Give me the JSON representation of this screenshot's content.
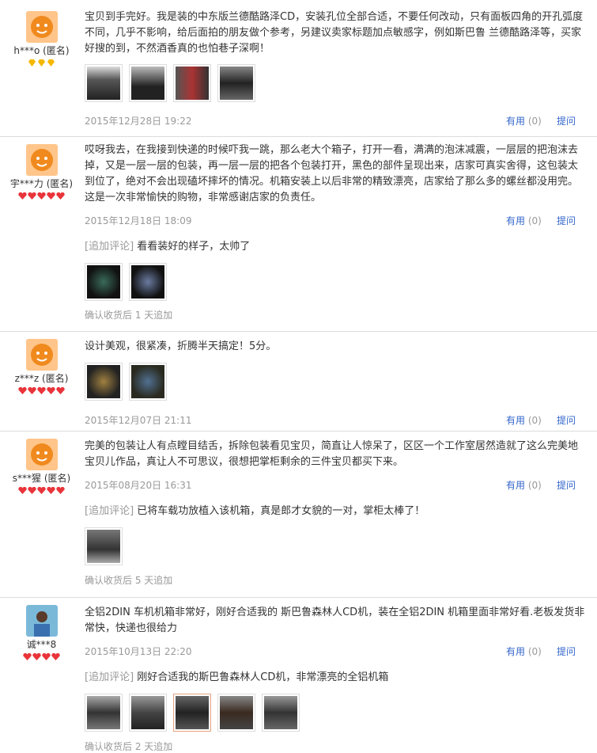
{
  "labels": {
    "useful": "有用",
    "ask": "提问",
    "append_tag": "[追加评论]"
  },
  "reviews": [
    {
      "user": "h***o (匿名)",
      "text": "宝贝到手完好。我是装的中东版兰德酷路泽CD，安装孔位全部合适，不要任何改动，只有面板四角的开孔弧度不同，几乎不影响，给后面拍的朋友做个参考，另建议卖家标题加点敏感字，例如斯巴鲁 兰德酷路泽等，买家好搜的到，不然酒香真的也怕巷子深啊！",
      "date": "2015年12月28日 19:22",
      "useful_count": "(0)"
    },
    {
      "user": "宇***力 (匿名)",
      "text": "哎呀我去，在我接到快递的时候吓我一跳，那么老大个箱子，打开一看，满满的泡沫减震，一层层的把泡沫去掉，又是一层一层的包装，再一层一层的把各个包装打开，黑色的部件呈现出来，店家可真实舍得，这包装太到位了，绝对不会出现磕坏摔坏的情况。机箱安装上以后非常的精致漂亮，店家给了那么多的螺丝都没用完。 这是一次非常愉快的购物，非常感谢店家的负责任。",
      "date": "2015年12月18日 18:09",
      "useful_count": "(0)",
      "append_text": "看看装好的样子，太帅了",
      "append_time": "确认收货后 1 天追加"
    },
    {
      "user": "z***z (匿名)",
      "text": "设计美观，很紧凑，折腾半天搞定！5分。",
      "date": "2015年12月07日 21:11",
      "useful_count": "(0)"
    },
    {
      "user": "s***猩 (匿名)",
      "text": "完美的包装让人有点瞠目结舌，拆除包装看见宝贝，简直让人惊呆了，区区一个工作室居然造就了这么完美地宝贝儿作品，真让人不可思议，很想把掌柜剩余的三件宝贝都买下来。",
      "date": "2015年08月20日 16:31",
      "useful_count": "(0)",
      "append_text": "已将车载功放植入该机箱，真是郎才女貌的一对，掌柜太棒了！",
      "append_time": "确认收货后 5 天追加"
    },
    {
      "user": "诚***8",
      "text": "全铝2DIN 车机机箱非常好，刚好合适我的 斯巴鲁森林人CD机，装在全铝2DIN 机箱里面非常好看.老板发货非常快，快递也很给力",
      "date": "2015年10月13日 22:20",
      "useful_count": "(0)",
      "append_text": "刚好合适我的斯巴鲁森林人CD机，非常漂亮的全铝机箱",
      "append_time": "确认收货后 2 天追加"
    }
  ],
  "colors": {
    "link": "#3366cc",
    "muted": "#999999",
    "rank_gold": "#f5b800",
    "rank_red": "#e8343a"
  }
}
